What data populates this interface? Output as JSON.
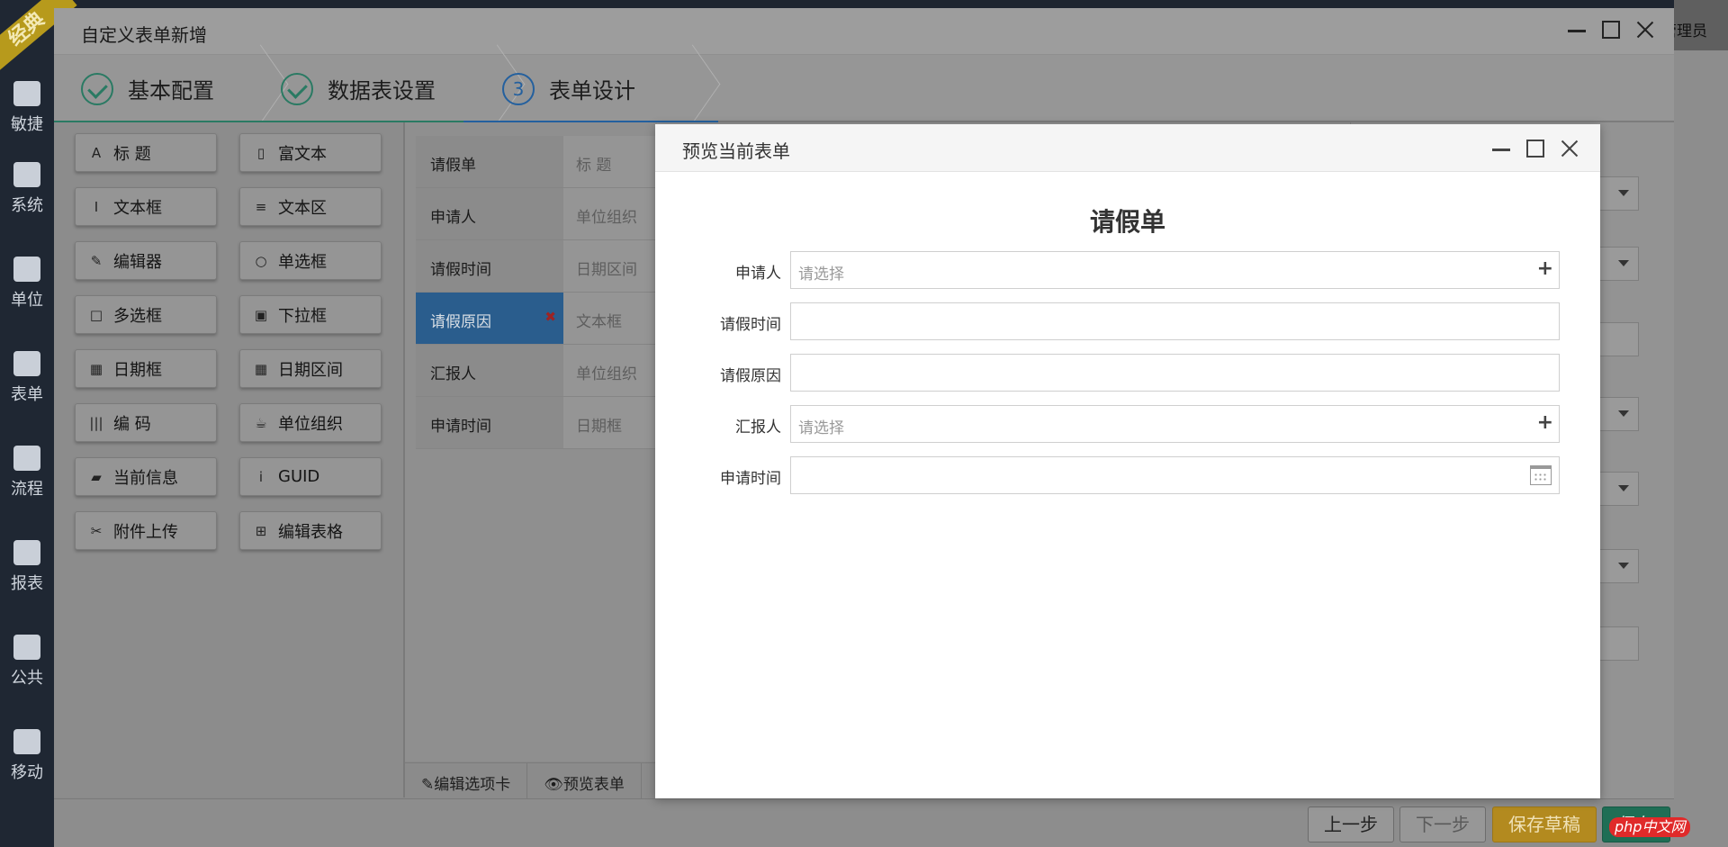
{
  "app": {
    "ribbon": "经典",
    "admin": "管理员",
    "nav": [
      "敏捷",
      "系统",
      "单位",
      "表单",
      "流程",
      "报表",
      "公共",
      "移动"
    ]
  },
  "outer_dialog": {
    "title": "自定义表单新增",
    "steps": [
      {
        "label": "基本配置",
        "state": "done"
      },
      {
        "label": "数据表设置",
        "state": "done"
      },
      {
        "number": "3",
        "label": "表单设计",
        "state": "active"
      }
    ]
  },
  "palette": [
    {
      "icon": "A",
      "label": "标 题"
    },
    {
      "icon": "▯",
      "label": "富文本"
    },
    {
      "icon": "I",
      "label": "文本框"
    },
    {
      "icon": "≡",
      "label": "文本区"
    },
    {
      "icon": "✎",
      "label": "编辑器"
    },
    {
      "icon": "○",
      "label": "单选框"
    },
    {
      "icon": "□",
      "label": "多选框"
    },
    {
      "icon": "▣",
      "label": "下拉框"
    },
    {
      "icon": "▦",
      "label": "日期框"
    },
    {
      "icon": "▦",
      "label": "日期区间"
    },
    {
      "icon": "|||",
      "label": "编 码"
    },
    {
      "icon": "☕",
      "label": "单位组织"
    },
    {
      "icon": "▰",
      "label": "当前信息"
    },
    {
      "icon": "i",
      "label": "GUID"
    },
    {
      "icon": "✂",
      "label": "附件上传"
    },
    {
      "icon": "⊞",
      "label": "编辑表格"
    }
  ],
  "fields": [
    {
      "name": "请假单",
      "type": "标 题"
    },
    {
      "name": "申请人",
      "type": "单位组织"
    },
    {
      "name": "请假时间",
      "type": "日期区间"
    },
    {
      "name": "请假原因",
      "type": "文本框",
      "selected": true
    },
    {
      "name": "汇报人",
      "type": "单位组织"
    },
    {
      "name": "申请时间",
      "type": "日期框"
    }
  ],
  "field_tabs": {
    "edit_tab": "编辑选项卡",
    "preview": "预览表单"
  },
  "bottom": {
    "prev": "上一步",
    "next": "下一步",
    "draft": "保存草稿",
    "save": "保存"
  },
  "preview_dialog": {
    "title": "预览当前表单",
    "form_title": "请假单",
    "rows": [
      {
        "label": "申请人",
        "placeholder": "请选择",
        "kind": "picker"
      },
      {
        "label": "请假时间",
        "placeholder": "",
        "kind": "text"
      },
      {
        "label": "请假原因",
        "placeholder": "",
        "kind": "text"
      },
      {
        "label": "汇报人",
        "placeholder": "请选择",
        "kind": "picker"
      },
      {
        "label": "申请时间",
        "placeholder": "",
        "kind": "date"
      }
    ]
  },
  "watermark": "php中文网",
  "colors": {
    "step_done": "#2a7a63",
    "step_active": "#24609e",
    "selected_field": "#2a5d8d",
    "draft": "#b38a1f",
    "save": "#1f6e55"
  }
}
